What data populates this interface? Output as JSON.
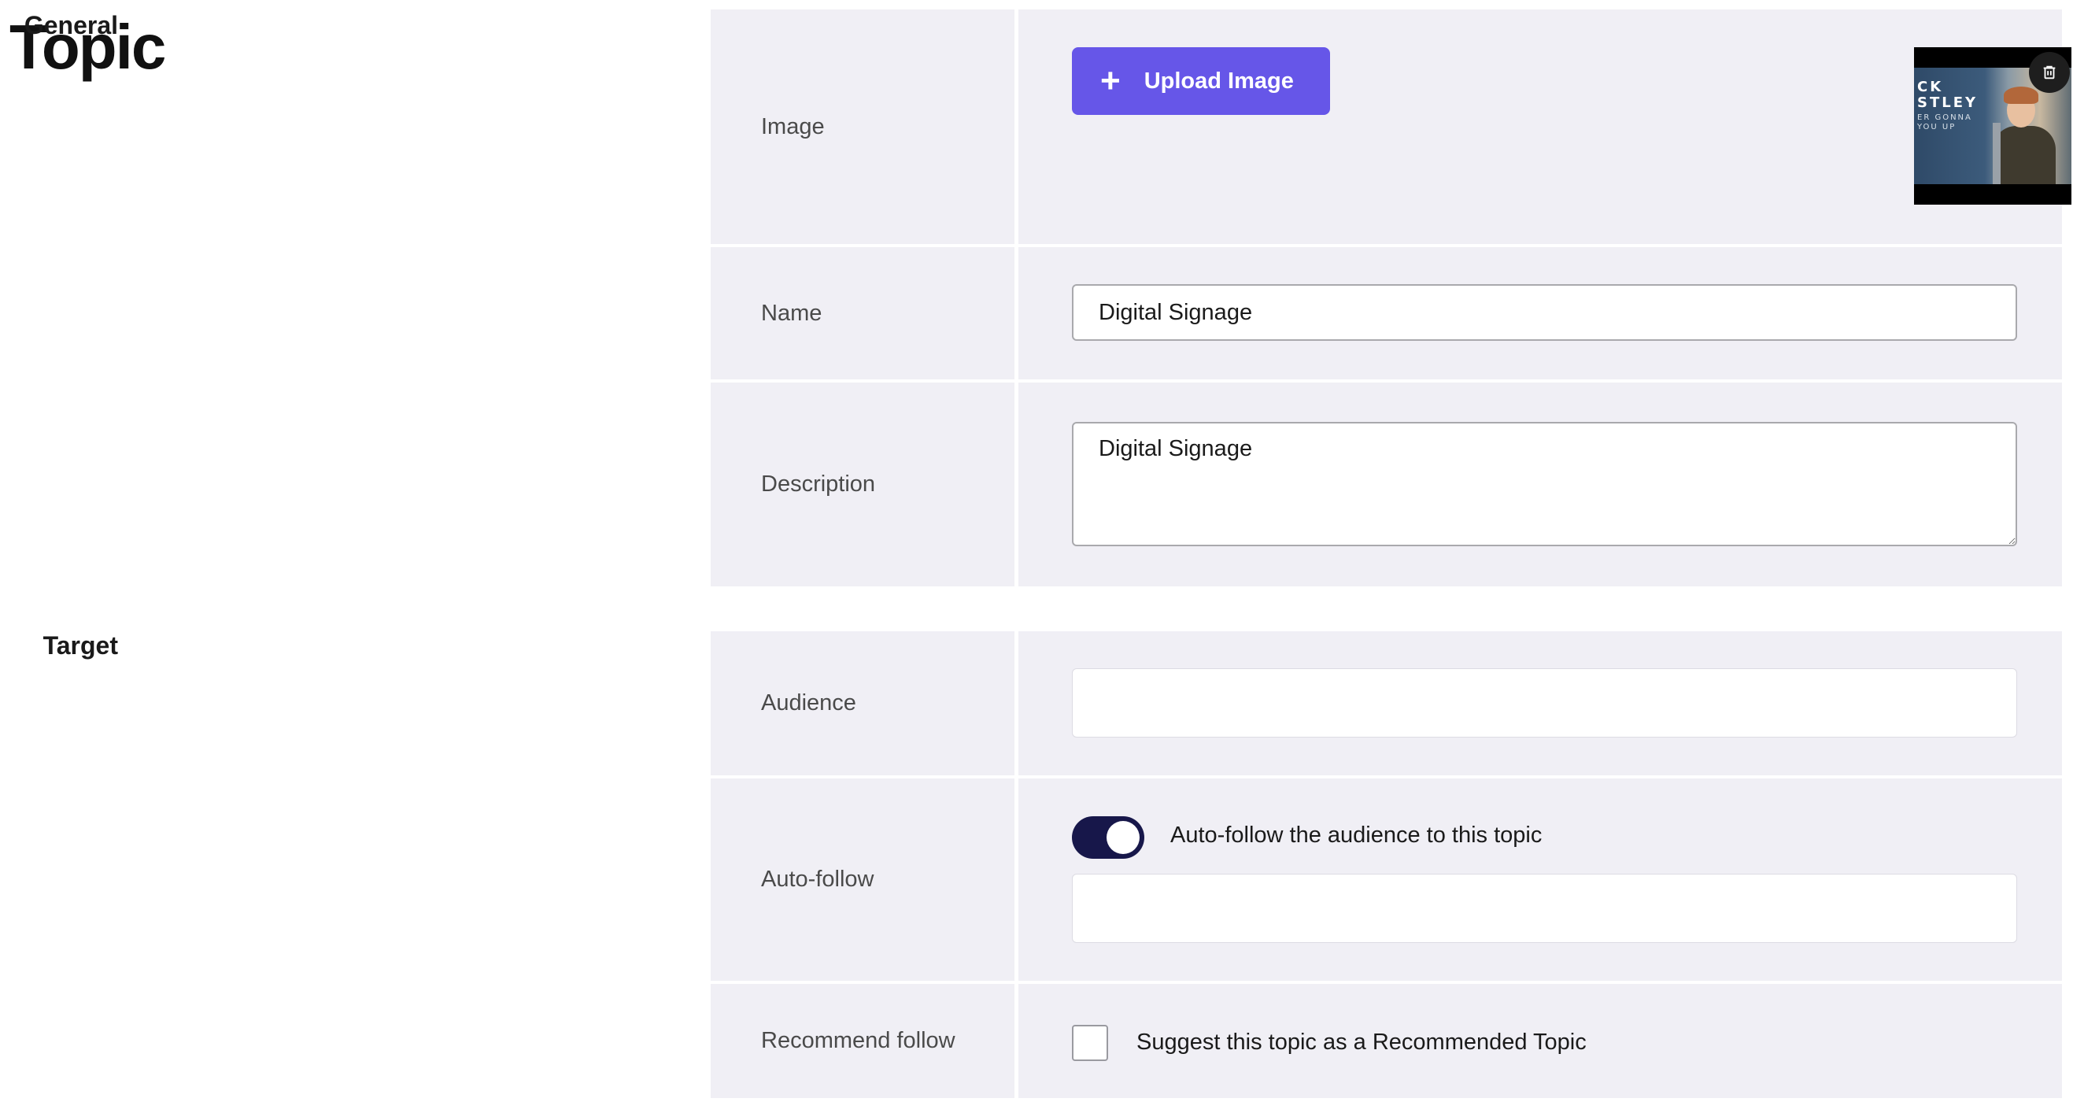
{
  "page": {
    "title": "Topic"
  },
  "sections": {
    "general": {
      "title": "General",
      "image": {
        "label": "Image",
        "upload_label": "Upload Image",
        "thumbnail_text": [
          "CK",
          "STLEY",
          "ER GONNA",
          "YOU UP"
        ],
        "delete_icon": "trash-icon"
      },
      "name": {
        "label": "Name",
        "value": "Digital Signage"
      },
      "description": {
        "label": "Description",
        "value": "Digital Signage"
      }
    },
    "target": {
      "title": "Target",
      "audience": {
        "label": "Audience",
        "value": ""
      },
      "auto_follow": {
        "label": "Auto-follow",
        "toggle_on": true,
        "toggle_label": "Auto-follow the audience to this topic",
        "value": ""
      },
      "recommend": {
        "label": "Recommend follow",
        "checked": false,
        "checkbox_label": "Suggest this topic as a Recommended Topic"
      }
    }
  },
  "colors": {
    "accent": "#6656e8",
    "toggle_on": "#17174a",
    "panel_bg": "#f0eff5"
  }
}
